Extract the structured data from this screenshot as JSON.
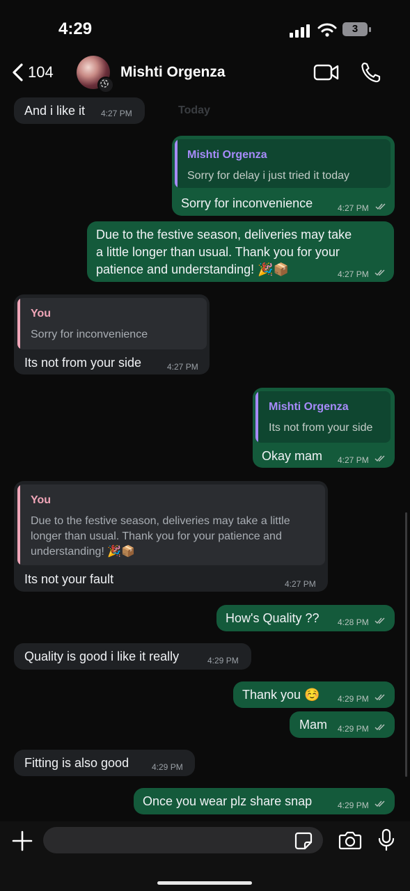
{
  "status_bar": {
    "time": "4:29",
    "battery": "3"
  },
  "header": {
    "back_count": "104",
    "contact_name": "Mishti Orgenza"
  },
  "chat": {
    "date_separator": "Today",
    "messages": [
      {
        "dir": "in",
        "text": "And i like it",
        "time": "4:27 PM"
      },
      {
        "dir": "out",
        "quote_name": "Mishti Orgenza",
        "quote_text": "Sorry for delay i just tried it today",
        "text": "Sorry for inconvenience",
        "time": "4:27 PM"
      },
      {
        "dir": "out",
        "lines": [
          "Due to the festive season, deliveries may take",
          "a little longer than usual. Thank you for your",
          "patience and understanding! 🎉📦"
        ],
        "time": "4:27 PM"
      },
      {
        "dir": "in",
        "quote_name": "You",
        "quote_text": "Sorry for inconvenience",
        "text": "Its not from your side",
        "time": "4:27 PM"
      },
      {
        "dir": "out",
        "quote_name": "Mishti Orgenza",
        "quote_text": "Its not from your side",
        "text": "Okay mam",
        "time": "4:27 PM"
      },
      {
        "dir": "in",
        "quote_name": "You",
        "quote_lines": [
          "Due to the festive season, deliveries may take a little",
          "longer than usual. Thank you for your patience and",
          "understanding! 🎉📦"
        ],
        "text": "Its not your fault",
        "time": "4:27 PM"
      },
      {
        "dir": "out",
        "text": "How's Quality ??",
        "time": "4:28 PM"
      },
      {
        "dir": "in",
        "text": "Quality is good i like it really",
        "time": "4:29 PM"
      },
      {
        "dir": "out",
        "text": "Thank you ☺️",
        "time": "4:29 PM"
      },
      {
        "dir": "out",
        "text": "Mam",
        "time": "4:29 PM"
      },
      {
        "dir": "in",
        "text": "Fitting is also good",
        "time": "4:29 PM"
      },
      {
        "dir": "out",
        "text": "Once you wear plz share snap",
        "time": "4:29 PM"
      }
    ]
  },
  "composer": {
    "placeholder": ""
  },
  "colors": {
    "outgoing": "#145a3b",
    "incoming": "#1f2124",
    "quote_other": "#a78bfa",
    "quote_you": "#f0a6b8"
  },
  "icons": [
    "back-chevron-icon",
    "video-call-icon",
    "phone-icon",
    "plus-icon",
    "sticker-icon",
    "camera-icon",
    "microphone-icon"
  ]
}
